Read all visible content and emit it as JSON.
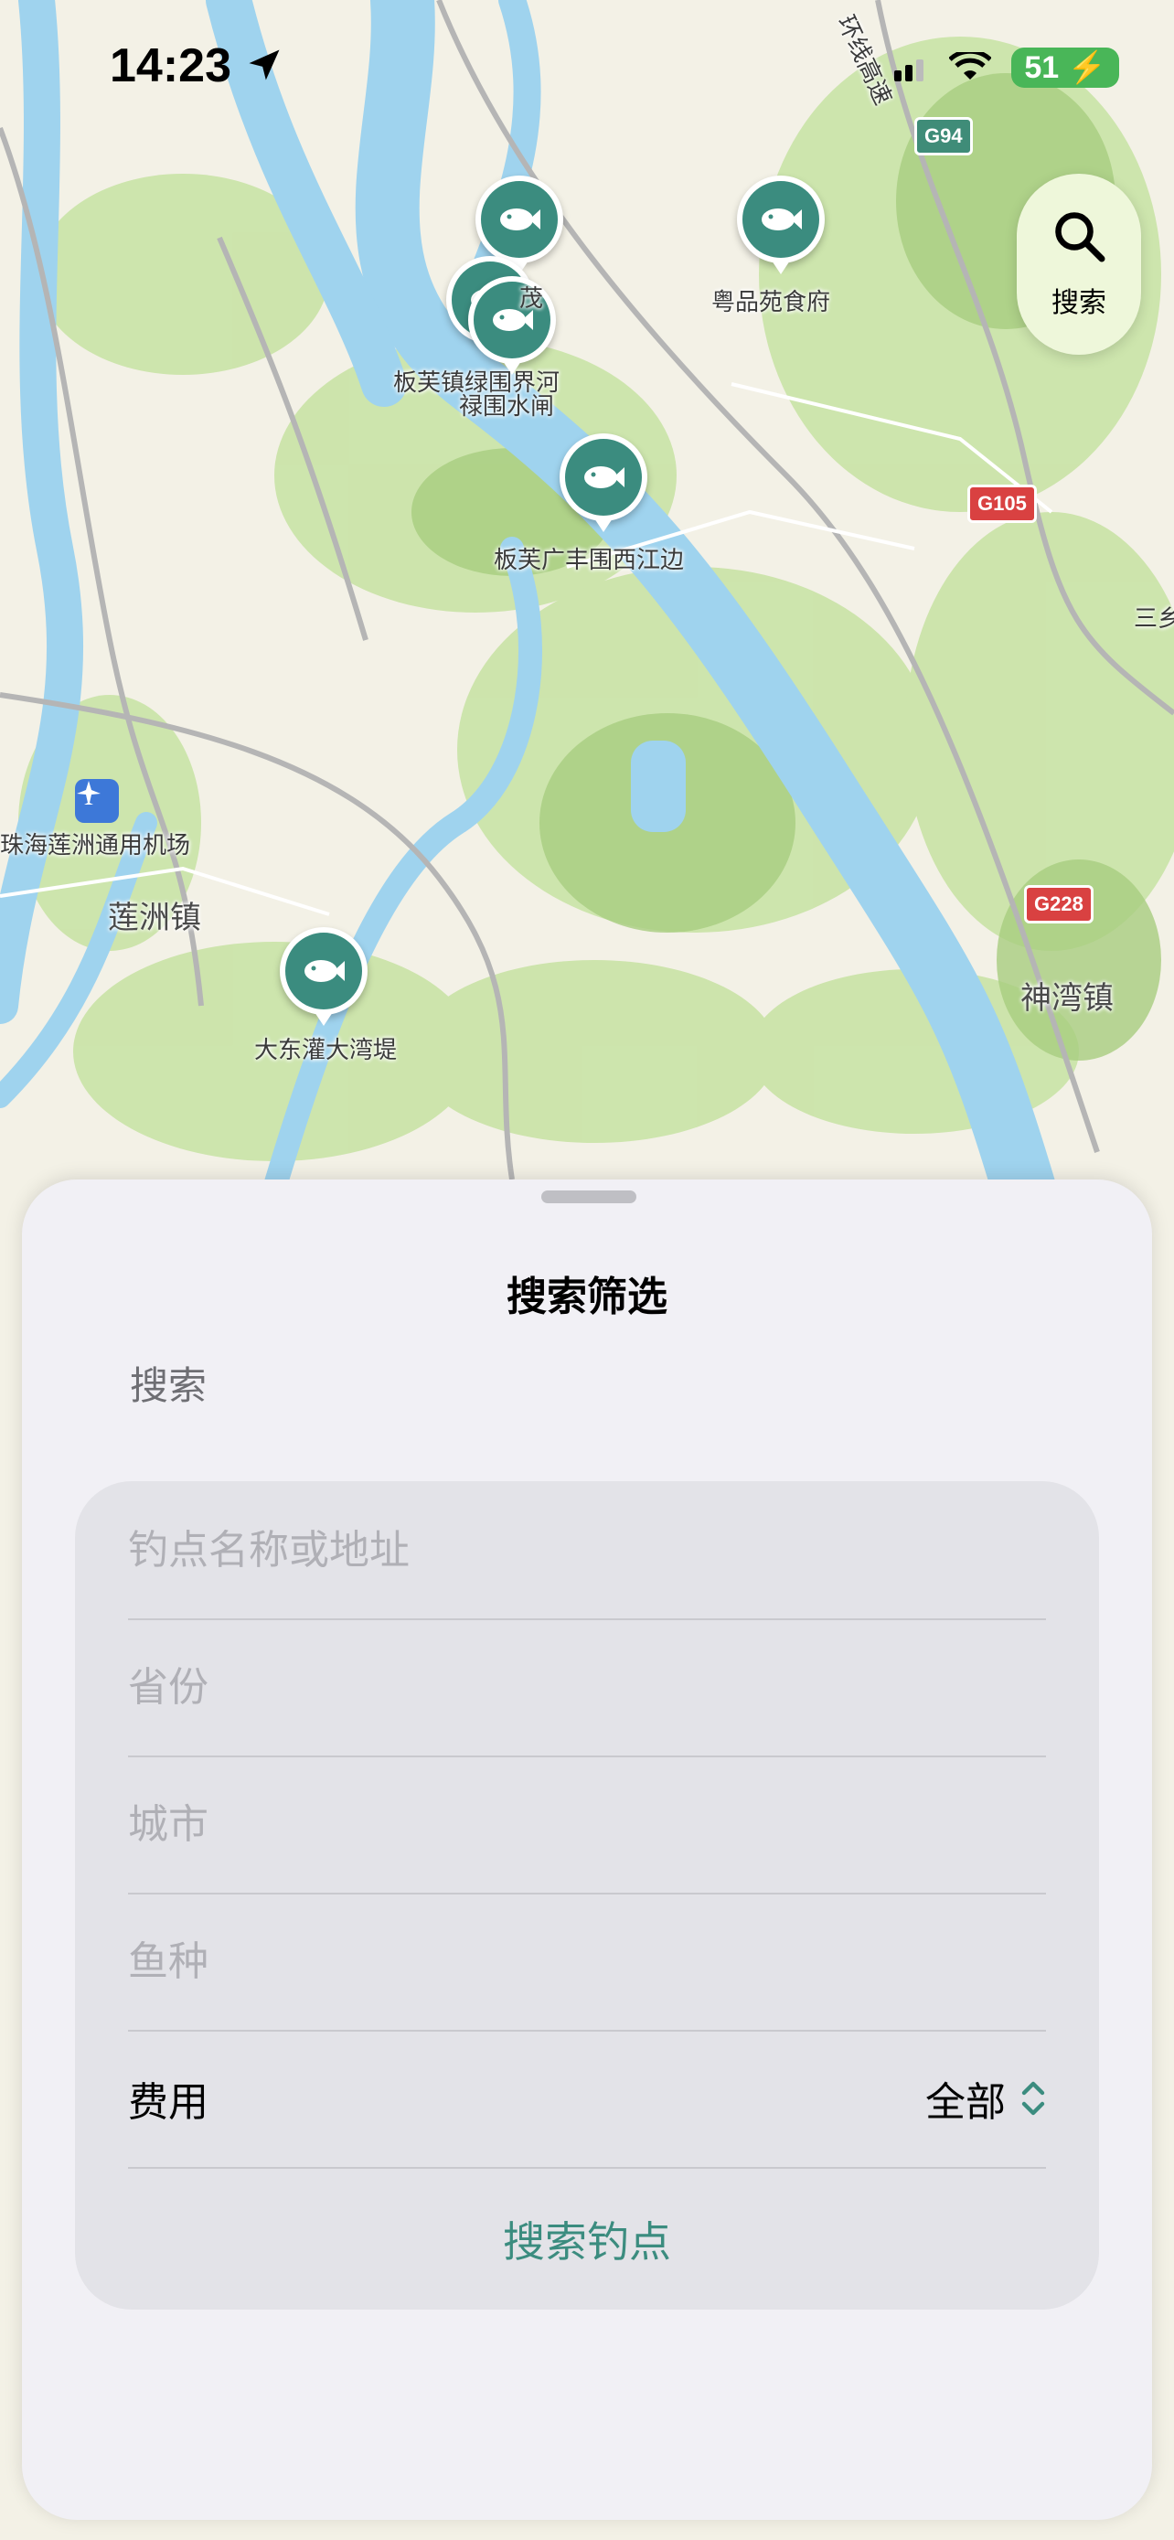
{
  "status_bar": {
    "time": "14:23",
    "battery": "51"
  },
  "map": {
    "labels": {
      "yuepin": "粤品苑食府",
      "banfu_lv": "板芙镇绿围界河",
      "lu_wei": "禄围水闸",
      "mao": "茂",
      "banfu_guangfeng": "板芙广丰围西江边",
      "airport": "珠海莲洲通用机场",
      "lianzhou": "莲洲镇",
      "dadong": "大东灌大湾堤",
      "shenwan": "神湾镇",
      "san": "三乡",
      "highway": "环线高速"
    },
    "shields": {
      "g94": "G94",
      "g105": "G105",
      "g228": "G228"
    }
  },
  "search_fab": {
    "label": "搜索",
    "icon": "search-icon"
  },
  "sheet": {
    "title": "搜索筛选",
    "section_label": "搜索",
    "fields": {
      "name_placeholder": "钓点名称或地址",
      "province_placeholder": "省份",
      "city_placeholder": "城市",
      "fish_placeholder": "鱼种"
    },
    "fee": {
      "label": "费用",
      "value": "全部"
    },
    "submit_label": "搜索钓点"
  },
  "colors": {
    "accent": "#3b8c7f",
    "sheet_bg": "#f1f0f5",
    "form_bg": "#e3e3e8"
  }
}
